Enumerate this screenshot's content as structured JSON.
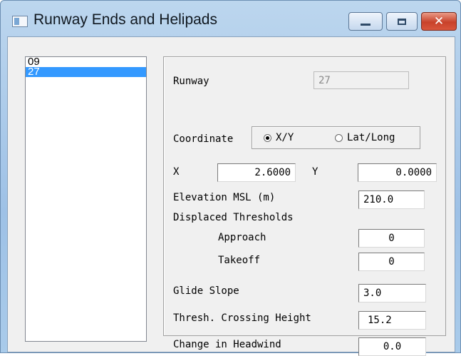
{
  "window": {
    "title": "Runway Ends and Helipads"
  },
  "runway_list": {
    "items": [
      {
        "label": "09",
        "selected": false
      },
      {
        "label": "27",
        "selected": true
      }
    ]
  },
  "panel": {
    "runway": {
      "label": "Runway",
      "value": "27"
    },
    "coordinates": {
      "label": "Coordinate",
      "options": [
        {
          "label": "X/Y",
          "checked": true
        },
        {
          "label": "Lat/Long",
          "checked": false
        }
      ]
    },
    "x": {
      "label": "X",
      "value": "2.6000"
    },
    "y": {
      "label": "Y",
      "value": "0.0000"
    },
    "elevation": {
      "label": "Elevation MSL (m)",
      "value": "210.0"
    },
    "displaced_thresholds": {
      "label": "Displaced Thresholds"
    },
    "approach": {
      "label": "Approach",
      "value": "0"
    },
    "takeoff": {
      "label": "Takeoff",
      "value": "0"
    },
    "glide_slope": {
      "label": "Glide Slope",
      "value": "3.0"
    },
    "thresh_crossing_height": {
      "label": "Thresh. Crossing Height",
      "value": "15.2"
    },
    "change_in_headwind": {
      "label": "Change in Headwind",
      "value": "0.0"
    }
  },
  "icons": {
    "app": "window-app-icon",
    "minimize": "minimize-icon",
    "maximize": "maximize-icon",
    "close": "close-icon"
  },
  "colors": {
    "list_selection": "#3399ff",
    "close_button": "#c8412a",
    "titlebar": "#9ec1e6"
  }
}
